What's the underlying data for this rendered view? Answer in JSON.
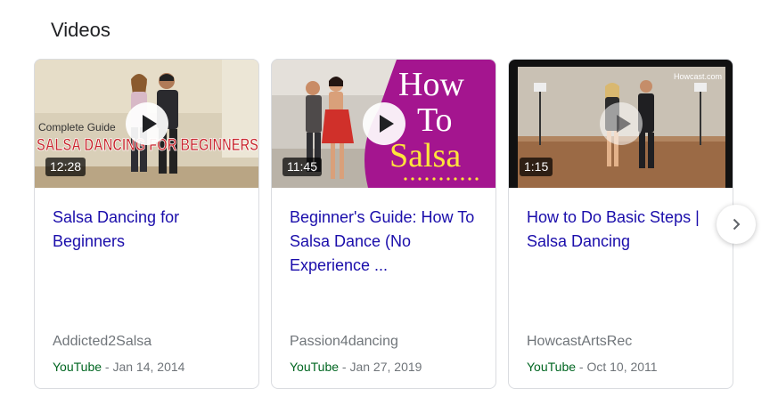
{
  "section": {
    "title": "Videos"
  },
  "videos": [
    {
      "title": "Salsa Dancing for Beginners",
      "duration": "12:28",
      "channel": "Addicted2Salsa",
      "source": "YouTube",
      "date": "Jan 14, 2014",
      "thumb_text_small": "Complete Guide",
      "thumb_text_big": "SALSA DANCING FOR BEGINNERS"
    },
    {
      "title": "Beginner's Guide: How To Salsa Dance (No Experience ...",
      "duration": "11:45",
      "channel": "Passion4dancing",
      "source": "YouTube",
      "date": "Jan 27, 2019",
      "thumb_text_line1": "How",
      "thumb_text_line2": "To",
      "thumb_text_line3": "Salsa"
    },
    {
      "title": "How to Do Basic Steps | Salsa Dancing",
      "duration": "1:15",
      "channel": "HowcastArtsRec",
      "source": "YouTube",
      "date": "Oct 10, 2011",
      "thumb_watermark": "Howcast.com"
    }
  ],
  "separator": " - ",
  "icons": {
    "play": "play-icon",
    "next": "chevron-right-icon"
  },
  "colors": {
    "link": "#1a0dab",
    "source": "#006621",
    "meta": "#70757a",
    "thumb2_bg": "#a4158f",
    "thumb2_text": "#ffe53b"
  }
}
